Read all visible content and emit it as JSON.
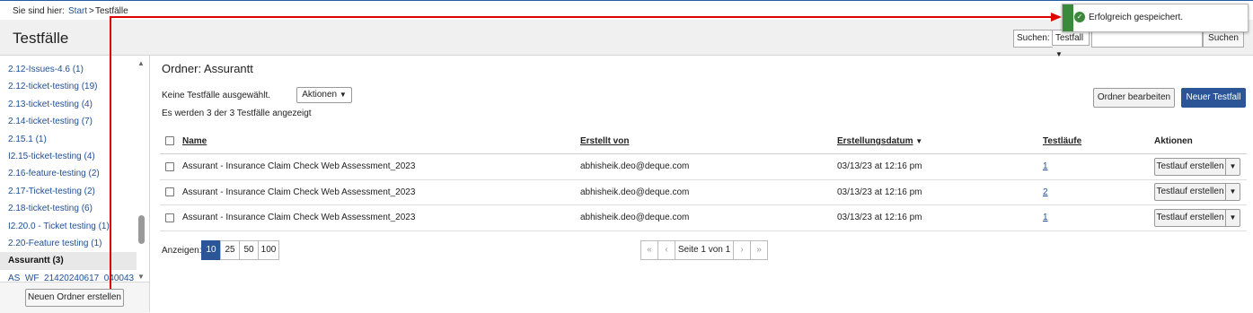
{
  "breadcrumb": {
    "label": "Sie sind hier:",
    "start": "Start",
    "separator": ">",
    "current": "Testfälle"
  },
  "header": {
    "title": "Testfälle",
    "search": {
      "label": "Suchen:",
      "scope": "Testfall",
      "value": "",
      "button": "Suchen"
    }
  },
  "toast": {
    "message": "Erfolgreich gespeichert.",
    "status": "success",
    "icon": "check-circle-icon",
    "color": "#3b8a3b"
  },
  "sidebar": {
    "folders": [
      {
        "label": "2.12-Issues-4.6 (1)"
      },
      {
        "label": "2.12-ticket-testing (19)"
      },
      {
        "label": "2.13-ticket-testing (4)"
      },
      {
        "label": "2.14-ticket-testing (7)"
      },
      {
        "label": "2.15.1 (1)"
      },
      {
        "label": "I2.15-ticket-testing (4)"
      },
      {
        "label": "2.16-feature-testing (2)"
      },
      {
        "label": "2.17-Ticket-testing (2)"
      },
      {
        "label": "2.18-ticket-testing (6)"
      },
      {
        "label": "I2.20.0 - Ticket testing (1)"
      },
      {
        "label": "2.20-Feature testing (1)"
      },
      {
        "label": "Assurantt (3)"
      },
      {
        "label": "AS_WF_21420240617_040043_"
      }
    ],
    "active_folder": "Assurantt (3)",
    "new_folder_button": "Neuen Ordner erstellen"
  },
  "main": {
    "folder_title": "Ordner: Assurantt",
    "selection_text": "Keine Testfälle ausgewählt.",
    "actions_dropdown": "Aktionen",
    "count_text": "Es werden 3 der 3 Testfälle angezeigt",
    "edit_folder_button": "Ordner bearbeiten",
    "new_case_button": "Neuer Testfall",
    "table": {
      "columns": {
        "name": "Name",
        "created_by": "Erstellt von",
        "created_date": "Erstellungsdatum",
        "runs": "Testläufe",
        "actions": "Aktionen"
      },
      "rows": [
        {
          "name": "Assurant - Insurance Claim Check Web Assessment_2023",
          "created_by": "abhisheik.deo@deque.com",
          "created_date": "03/13/23 at 12:16 pm",
          "runs": "1",
          "action": "Testlauf erstellen"
        },
        {
          "name": "Assurant - Insurance Claim Check Web Assessment_2023",
          "created_by": "abhisheik.deo@deque.com",
          "created_date": "03/13/23 at 12:16 pm",
          "runs": "2",
          "action": "Testlauf erstellen"
        },
        {
          "name": "Assurant - Insurance Claim Check Web Assessment_2023",
          "created_by": "abhisheik.deo@deque.com",
          "created_date": "03/13/23 at 12:16 pm",
          "runs": "1",
          "action": "Testlauf erstellen"
        }
      ]
    },
    "pagination": {
      "show_label": "Anzeigen:",
      "sizes": [
        "10",
        "25",
        "50",
        "100"
      ],
      "active_size": "10",
      "page_info": "Seite 1 von 1",
      "first": "«",
      "prev": "‹",
      "next": "›",
      "last": "»"
    }
  },
  "colors": {
    "primary": "#2b5597",
    "link": "#1f4f96",
    "success": "#3b8a3b",
    "annotation": "#e00000"
  }
}
